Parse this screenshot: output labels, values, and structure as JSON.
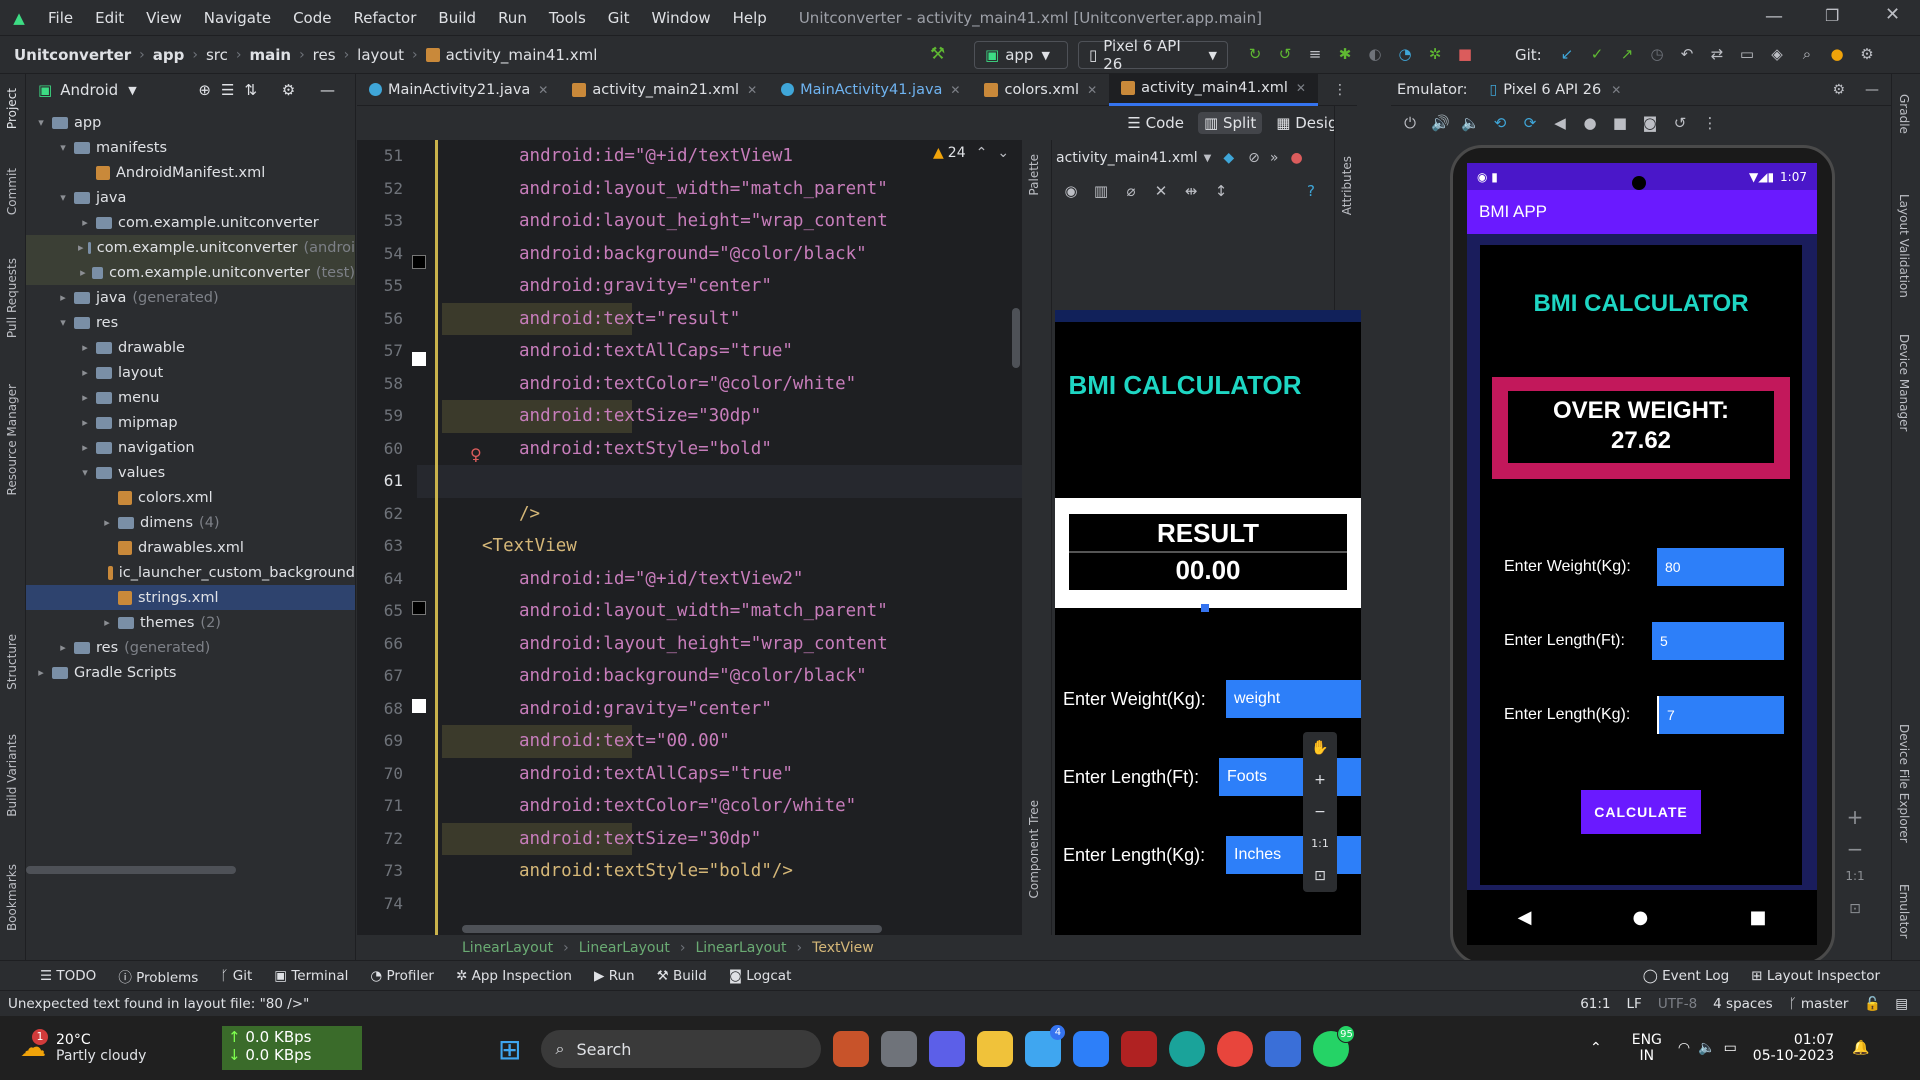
{
  "window": {
    "menu": [
      "File",
      "Edit",
      "View",
      "Navigate",
      "Code",
      "Refactor",
      "Build",
      "Run",
      "Tools",
      "Git",
      "Window",
      "Help"
    ],
    "title": "Unitconverter - activity_main41.xml [Unitconverter.app.main]"
  },
  "breadcrumb": [
    "Unitconverter",
    "app",
    "src",
    "main",
    "res",
    "layout",
    "activity_main41.xml"
  ],
  "toolbar": {
    "run_config": "app",
    "device": "Pixel 6 API 26",
    "git_label": "Git:"
  },
  "project": {
    "view_label": "Android",
    "tree": [
      {
        "label": "app",
        "level": 0,
        "kind": "folder"
      },
      {
        "label": "manifests",
        "level": 1,
        "kind": "folder"
      },
      {
        "label": "AndroidManifest.xml",
        "level": 2,
        "kind": "xml"
      },
      {
        "label": "java",
        "level": 1,
        "kind": "folder"
      },
      {
        "label": "com.example.unitconverter",
        "level": 2,
        "kind": "folder"
      },
      {
        "label": "com.example.unitconverter",
        "level": 2,
        "kind": "folder",
        "suffix": "(androi"
      },
      {
        "label": "com.example.unitconverter",
        "level": 2,
        "kind": "folder",
        "suffix": "(test)"
      },
      {
        "label": "java",
        "level": 1,
        "kind": "folder",
        "suffix": "(generated)"
      },
      {
        "label": "res",
        "level": 1,
        "kind": "folder"
      },
      {
        "label": "drawable",
        "level": 2,
        "kind": "folder"
      },
      {
        "label": "layout",
        "level": 2,
        "kind": "folder"
      },
      {
        "label": "menu",
        "level": 2,
        "kind": "folder"
      },
      {
        "label": "mipmap",
        "level": 2,
        "kind": "folder"
      },
      {
        "label": "navigation",
        "level": 2,
        "kind": "folder"
      },
      {
        "label": "values",
        "level": 2,
        "kind": "folder"
      },
      {
        "label": "colors.xml",
        "level": 3,
        "kind": "xml"
      },
      {
        "label": "dimens",
        "level": 3,
        "kind": "folder",
        "suffix": "(4)"
      },
      {
        "label": "drawables.xml",
        "level": 3,
        "kind": "xml"
      },
      {
        "label": "ic_launcher_custom_background",
        "level": 3,
        "kind": "xml"
      },
      {
        "label": "strings.xml",
        "level": 3,
        "kind": "xml",
        "selected": true
      },
      {
        "label": "themes",
        "level": 3,
        "kind": "folder",
        "suffix": "(2)"
      },
      {
        "label": "res",
        "level": 1,
        "kind": "folder",
        "suffix": "(generated)"
      },
      {
        "label": "Gradle Scripts",
        "level": 0,
        "kind": "folder"
      }
    ]
  },
  "tabs": [
    {
      "label": "MainActivity21.java",
      "color": "#3fa6d8"
    },
    {
      "label": "activity_main21.xml",
      "color": "#c9893a"
    },
    {
      "label": "MainActivity41.java",
      "color": "#3fa6d8"
    },
    {
      "label": "colors.xml",
      "color": "#c9893a"
    },
    {
      "label": "activity_main41.xml",
      "color": "#c9893a",
      "active": true
    }
  ],
  "view_modes": [
    "Code",
    "Split",
    "Design"
  ],
  "warning_count": "24",
  "code_lines": [
    {
      "n": "51",
      "t": "android:id=\"@+id/textView1"
    },
    {
      "n": "52",
      "t": "android:layout_width=\"match_parent\""
    },
    {
      "n": "53",
      "t": "android:layout_height=\"wrap_content"
    },
    {
      "n": "54",
      "t": "android:background=\"@color/black\""
    },
    {
      "n": "55",
      "t": "android:gravity=\"center\""
    },
    {
      "n": "56",
      "t": "android:text=\"result\""
    },
    {
      "n": "57",
      "t": "android:textAllCaps=\"true\""
    },
    {
      "n": "58",
      "t": "android:textColor=\"@color/white\""
    },
    {
      "n": "59",
      "t": "android:textSize=\"30dp\""
    },
    {
      "n": "60",
      "t": "android:textStyle=\"bold\""
    },
    {
      "n": "61",
      "t": ""
    },
    {
      "n": "62",
      "t": "/>"
    },
    {
      "n": "63",
      "t": "<TextView"
    },
    {
      "n": "64",
      "t": "android:id=\"@+id/textView2\""
    },
    {
      "n": "65",
      "t": "android:layout_width=\"match_parent\""
    },
    {
      "n": "66",
      "t": "android:layout_height=\"wrap_content"
    },
    {
      "n": "67",
      "t": "android:background=\"@color/black\""
    },
    {
      "n": "68",
      "t": "android:gravity=\"center\""
    },
    {
      "n": "69",
      "t": "android:text=\"00.00\""
    },
    {
      "n": "70",
      "t": "android:textAllCaps=\"true\""
    },
    {
      "n": "71",
      "t": "android:textColor=\"@color/white\""
    },
    {
      "n": "72",
      "t": "android:textSize=\"30dp\""
    },
    {
      "n": "73",
      "t": "android:textStyle=\"bold\"/>"
    },
    {
      "n": "74",
      "t": ""
    }
  ],
  "design_preview": {
    "file": "activity_main41.xml",
    "title": "BMI CALCULATOR",
    "result_label": "RESULT",
    "result_value": "00.00",
    "rows": [
      {
        "label": "Enter Weight(Kg):",
        "hint": "weight"
      },
      {
        "label": "Enter Length(Ft):",
        "hint": "Foots"
      },
      {
        "label": "Enter Length(Kg):",
        "hint": "Inches"
      }
    ]
  },
  "breadcrumb_bottom": [
    "LinearLayout",
    "LinearLayout",
    "LinearLayout",
    "TextView"
  ],
  "emulator": {
    "label": "Emulator:",
    "device_tab": "Pixel 6 API 26",
    "time": "1:07",
    "app_title": "BMI APP",
    "heading": "BMI CALCULATOR",
    "result_line1": "OVER WEIGHT:",
    "result_line2": "27.62",
    "rows": [
      {
        "label": "Enter Weight(Kg):",
        "value": "80"
      },
      {
        "label": "Enter Length(Ft):",
        "value": "5"
      },
      {
        "label": "Enter Length(Kg):",
        "value": "7"
      }
    ],
    "button": "CALCULATE",
    "zoom_reset": "1:1"
  },
  "bottom_tools": [
    "TODO",
    "Problems",
    "Git",
    "Terminal",
    "Profiler",
    "App Inspection",
    "Run",
    "Build",
    "Logcat"
  ],
  "bottom_right": [
    "Event Log",
    "Layout Inspector"
  ],
  "status": {
    "message": "Unexpected text found in layout file: \"80 />\"",
    "position": "61:1",
    "line_sep": "LF",
    "encoding": "UTF-8",
    "indent": "4 spaces",
    "branch": "master"
  },
  "side_tools_left": [
    "Project",
    "Commit",
    "Pull Requests",
    "Resource Manager",
    "Structure",
    "Build Variants",
    "Bookmarks"
  ],
  "side_tools_right": [
    "Gradle",
    "Layout Validation",
    "Device Manager",
    "Device File Explorer",
    "Emulator"
  ],
  "design_side": [
    "Palette",
    "Component Tree"
  ],
  "design_side_right": [
    "Attributes"
  ],
  "taskbar": {
    "weather_temp": "20°C",
    "weather_text": "Partly cloudy",
    "weather_badge": "1",
    "net_up": "0.0 KBps",
    "net_down": "0.0 KBps",
    "search": "Search",
    "lang": "ENG",
    "region": "IN",
    "time": "01:07",
    "date": "05-10-2023",
    "mail_badge": "4",
    "wa_badge": "95"
  },
  "colors": {
    "accent": "#3574f0",
    "app_purple": "#6a1aff",
    "result_border": "#c2185b",
    "teal": "#1ed6c3",
    "input_blue": "#2d7ff9"
  }
}
